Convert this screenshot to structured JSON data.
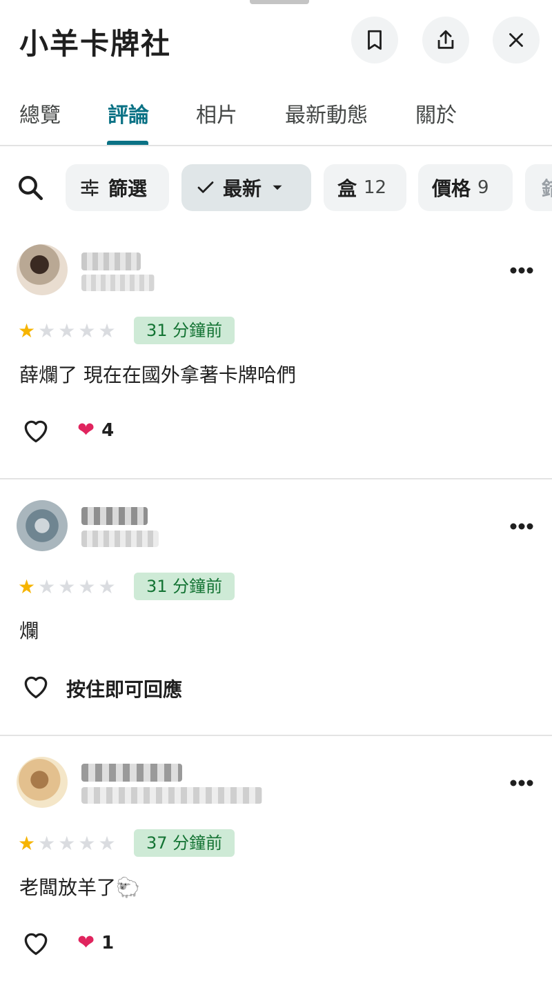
{
  "place": {
    "title": "小羊卡牌社"
  },
  "header": {
    "icons": [
      "bookmark-icon",
      "share-icon",
      "close-icon"
    ]
  },
  "tabs": [
    {
      "label": "總覽"
    },
    {
      "label": "評論"
    },
    {
      "label": "相片"
    },
    {
      "label": "最新動態"
    },
    {
      "label": "關於"
    }
  ],
  "active_tab": "評論",
  "filters": {
    "search_icon": "search-icon",
    "filter_label": "篩選",
    "sort_label": "最新",
    "topics": [
      {
        "label": "盒",
        "count": "12"
      },
      {
        "label": "價格",
        "count": "9"
      },
      {
        "label": "錯"
      }
    ]
  },
  "reviews": [
    {
      "rating": 1,
      "max_rating": 5,
      "time": "31 分鐘前",
      "text": "薛爛了 現在在國外拿著卡牌哈們",
      "reaction_emoji": "❤",
      "reaction_count": "4"
    },
    {
      "rating": 1,
      "max_rating": 5,
      "time": "31 分鐘前",
      "text": "爛",
      "hold_to_react": "按住即可回應"
    },
    {
      "rating": 1,
      "max_rating": 5,
      "time": "37 分鐘前",
      "text": "老闆放羊了🐑",
      "reaction_emoji": "❤",
      "reaction_count": "1"
    }
  ],
  "colors": {
    "accent": "#0b7285",
    "star_on": "#f6b400",
    "star_off": "#dadce0",
    "badge_bg": "#ceead6",
    "badge_text": "#137333"
  }
}
